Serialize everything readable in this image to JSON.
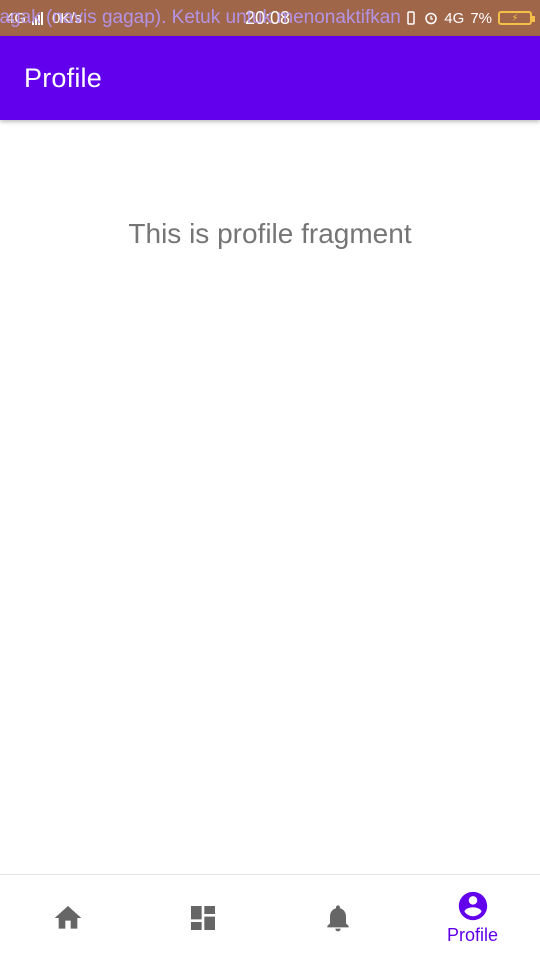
{
  "status_bar": {
    "network_left": "4G",
    "speed": "0K/s",
    "clock": "20:08",
    "network_right": "4G",
    "battery_percent": "7%",
    "ticker_text": "xagak (navis gagap). Ketuk untuk menonaktifkan",
    "background_color": "#a0664a"
  },
  "app_bar": {
    "title": "Profile",
    "background_color": "#6200ee"
  },
  "content": {
    "message": "This is profile fragment"
  },
  "bottom_nav": {
    "items": [
      {
        "icon": "home-icon",
        "label": "",
        "selected": false
      },
      {
        "icon": "dashboard-icon",
        "label": "",
        "selected": false
      },
      {
        "icon": "notifications-icon",
        "label": "",
        "selected": false
      },
      {
        "icon": "account-circle-icon",
        "label": "Profile",
        "selected": true
      }
    ],
    "selected_color": "#6200ee",
    "unselected_color": "#666666"
  }
}
